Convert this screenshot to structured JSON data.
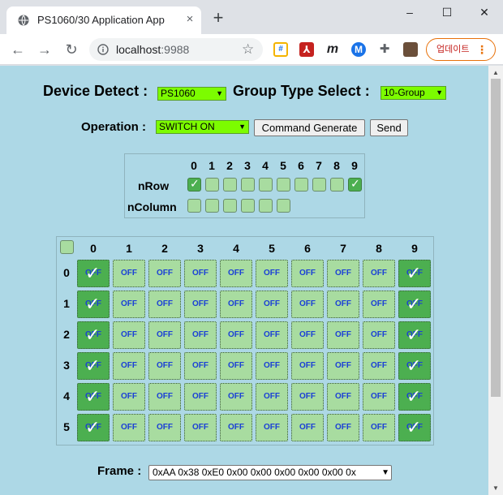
{
  "browser": {
    "tab_title": "PS1060/30 Application App",
    "url_host": "localhost",
    "url_port": ":9988",
    "update_label": "업데이트",
    "new_tab": "+",
    "close_tab": "×",
    "minimize": "–",
    "maximize": "☐",
    "close_window": "✕",
    "extensions": [
      "tab-icon",
      "pdf-icon",
      "m-icon",
      "pen-icon",
      "puzzle-icon",
      "profile-avatar"
    ]
  },
  "header": {
    "device_detect_label": "Device Detect :",
    "device_value": "PS1060",
    "group_type_label": "Group Type Select :",
    "group_value": "10-Group",
    "operation_label": "Operation :",
    "operation_value": "SWITCH ON",
    "command_generate": "Command Generate",
    "send": "Send"
  },
  "selector": {
    "column_headers": [
      "0",
      "1",
      "2",
      "3",
      "4",
      "5",
      "6",
      "7",
      "8",
      "9"
    ],
    "nrow_label": "nRow",
    "ncolumn_label": "nColumn",
    "nrow_checked": [
      true,
      false,
      false,
      false,
      false,
      false,
      false,
      false,
      false,
      true
    ],
    "ncolumn_count": 6
  },
  "grid": {
    "column_headers": [
      "0",
      "1",
      "2",
      "3",
      "4",
      "5",
      "6",
      "7",
      "8",
      "9"
    ],
    "row_headers": [
      "0",
      "1",
      "2",
      "3",
      "4",
      "5"
    ],
    "off_label": "OFF",
    "on_columns": [
      0,
      9
    ],
    "select_all_checked": false
  },
  "frame": {
    "label": "Frame :",
    "value": "0xAA 0x38 0xE0 0x00 0x00 0x00 0x00 0x00 0x"
  },
  "colors": {
    "page_bg": "#add8e6",
    "select_bg": "#7cfc00",
    "cell_off": "#a8dca0",
    "cell_on": "#4caf50",
    "off_text": "#1a3fd6"
  }
}
